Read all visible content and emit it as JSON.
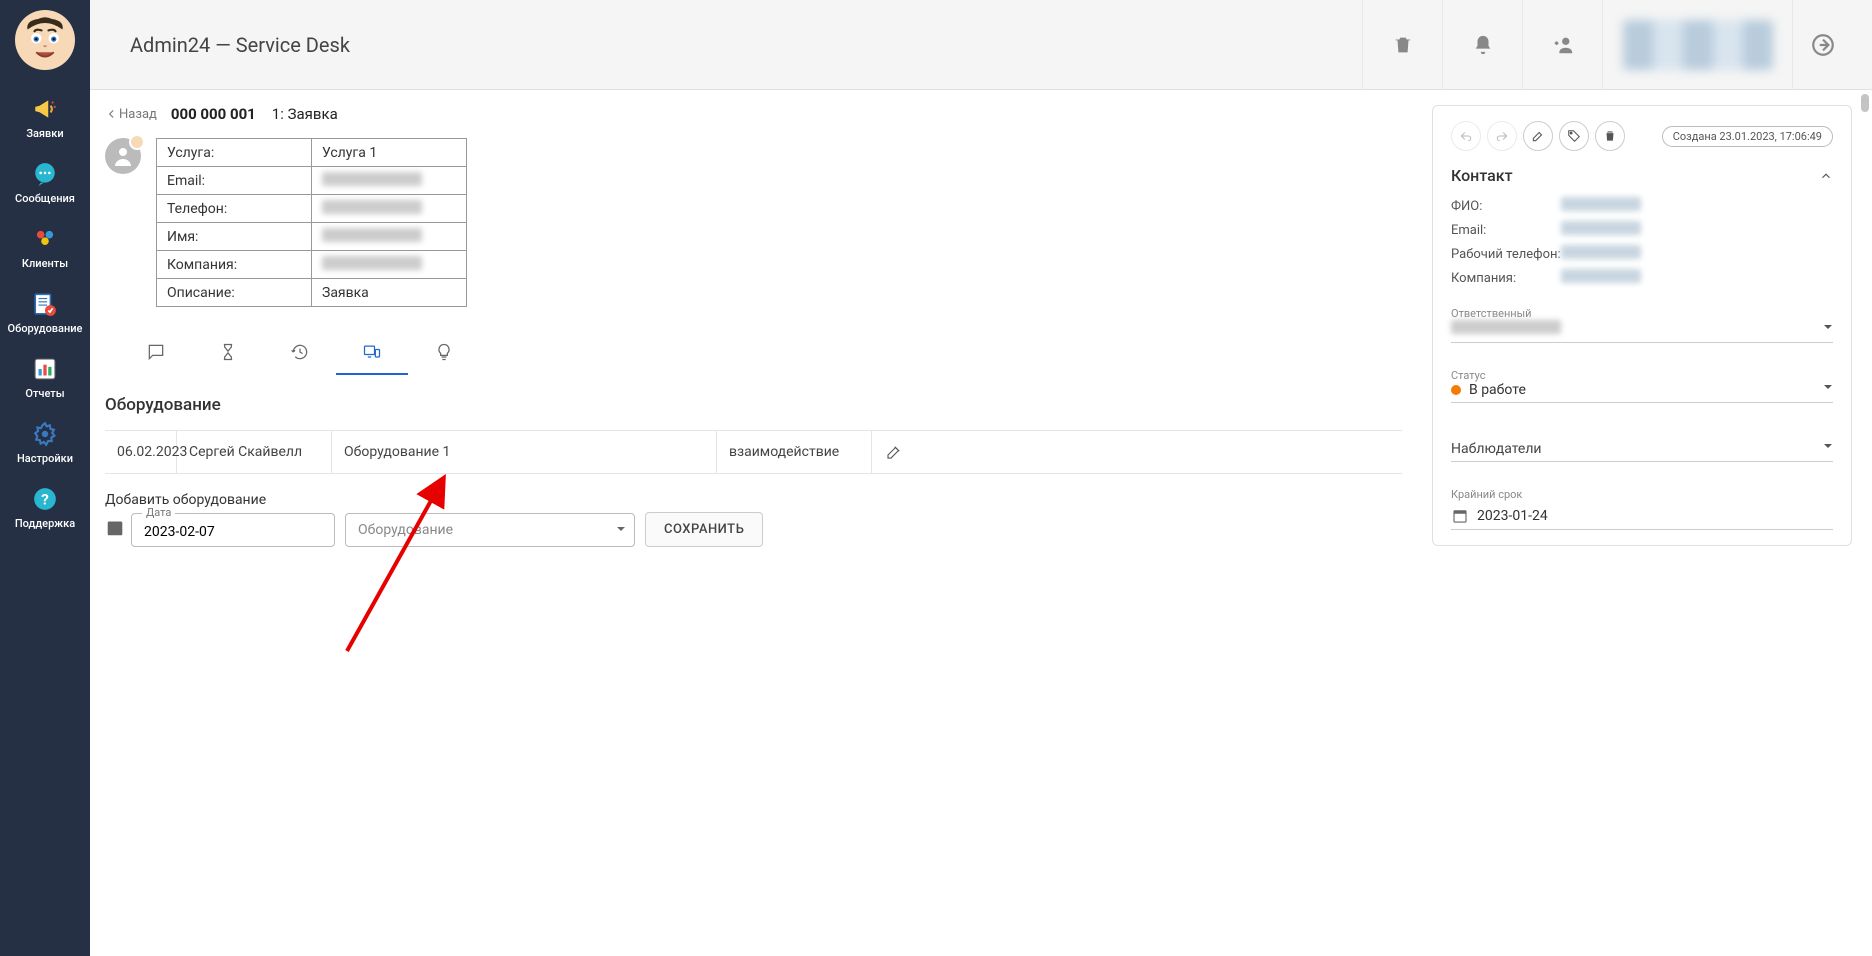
{
  "app": {
    "title": "Admin24 — Service Desk"
  },
  "sidebar": {
    "items": [
      {
        "label": "Заявки",
        "name": "sidebar-item-tickets",
        "icon": "megaphone"
      },
      {
        "label": "Сообщения",
        "name": "sidebar-item-messages",
        "icon": "chat"
      },
      {
        "label": "Клиенты",
        "name": "sidebar-item-clients",
        "icon": "people"
      },
      {
        "label": "Оборудование",
        "name": "sidebar-item-equipment",
        "icon": "equipment-list"
      },
      {
        "label": "Отчеты",
        "name": "sidebar-item-reports",
        "icon": "reports"
      },
      {
        "label": "Настройки",
        "name": "sidebar-item-settings",
        "icon": "gear"
      },
      {
        "label": "Поддержка",
        "name": "sidebar-item-support",
        "icon": "help"
      }
    ]
  },
  "breadcrumb": {
    "back": "Назад",
    "id": "000 000 001",
    "title": "1: Заявка"
  },
  "ticket_meta": {
    "rows": [
      {
        "label": "Услуга:",
        "value": "Услуга 1",
        "blurred": false
      },
      {
        "label": "Email:",
        "value": "",
        "blurred": true
      },
      {
        "label": "Телефон:",
        "value": "",
        "blurred": true
      },
      {
        "label": "Имя:",
        "value": "",
        "blurred": true
      },
      {
        "label": "Компания:",
        "value": "",
        "blurred": true
      },
      {
        "label": "Описание:",
        "value": "Заявка",
        "blurred": false
      }
    ]
  },
  "tabs": {
    "items": [
      {
        "name": "tab-comments",
        "icon": "comment"
      },
      {
        "name": "tab-time",
        "icon": "hourglass"
      },
      {
        "name": "tab-history",
        "icon": "history"
      },
      {
        "name": "tab-equipment",
        "icon": "devices"
      },
      {
        "name": "tab-ideas",
        "icon": "bulb"
      }
    ],
    "active_index": 3
  },
  "equipment": {
    "section_title": "Оборудование",
    "row": {
      "date": "06.02.2023",
      "author": "Сергей Скайвелл",
      "name": "Оборудование 1",
      "note": "взаимодействие"
    },
    "add": {
      "label": "Добавить оборудование",
      "date_label": "Дата",
      "date_value": "2023-02-07",
      "select_placeholder": "Оборудование",
      "save_btn": "СОХРАНИТЬ"
    }
  },
  "sidepanel": {
    "created_prefix": "Создана ",
    "created_at": "23.01.2023, 17:06:49",
    "contact": {
      "heading": "Контакт",
      "rows": [
        {
          "label": "ФИО:"
        },
        {
          "label": "Email:"
        },
        {
          "label": "Рабочий телефон:"
        },
        {
          "label": "Компания:"
        }
      ]
    },
    "responsible_label": "Ответственный",
    "status_label": "Статус",
    "status_value": "В работе",
    "status_color": "#f57c00",
    "watchers_label": "Наблюдатели",
    "deadline_label": "Крайний срок",
    "deadline_value": "2023-01-24"
  }
}
